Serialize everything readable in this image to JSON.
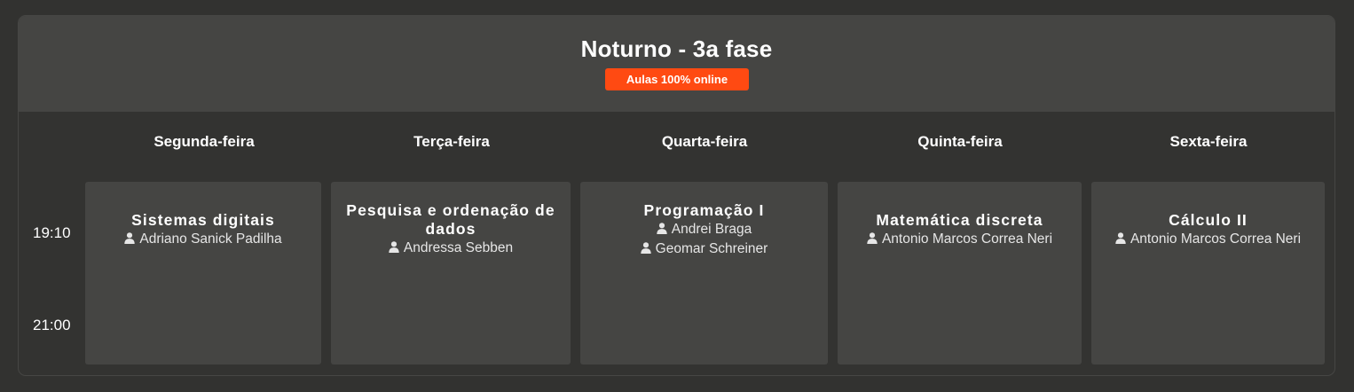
{
  "header": {
    "title": "Noturno - 3a fase",
    "badge": "Aulas 100% online"
  },
  "days": [
    "Segunda-feira",
    "Terça-feira",
    "Quarta-feira",
    "Quinta-feira",
    "Sexta-feira"
  ],
  "times": [
    "19:10",
    "21:00"
  ],
  "classes": [
    {
      "course": "Sistemas digitais",
      "teachers": [
        "Adriano Sanick Padilha"
      ]
    },
    {
      "course": "Pesquisa e ordenação de dados",
      "teachers": [
        "Andressa Sebben"
      ]
    },
    {
      "course": "Programação I",
      "teachers": [
        "Andrei Braga",
        "Geomar Schreiner"
      ]
    },
    {
      "course": "Matemática discreta",
      "teachers": [
        "Antonio Marcos Correa Neri"
      ]
    },
    {
      "course": "Cálculo II",
      "teachers": [
        "Antonio Marcos Correa Neri"
      ]
    }
  ],
  "colors": {
    "background": "#323230",
    "panel_header": "#454543",
    "card": "#454543",
    "badge": "#ff4a12",
    "text": "#ffffff"
  },
  "icons": {
    "teacher": "person-icon"
  }
}
